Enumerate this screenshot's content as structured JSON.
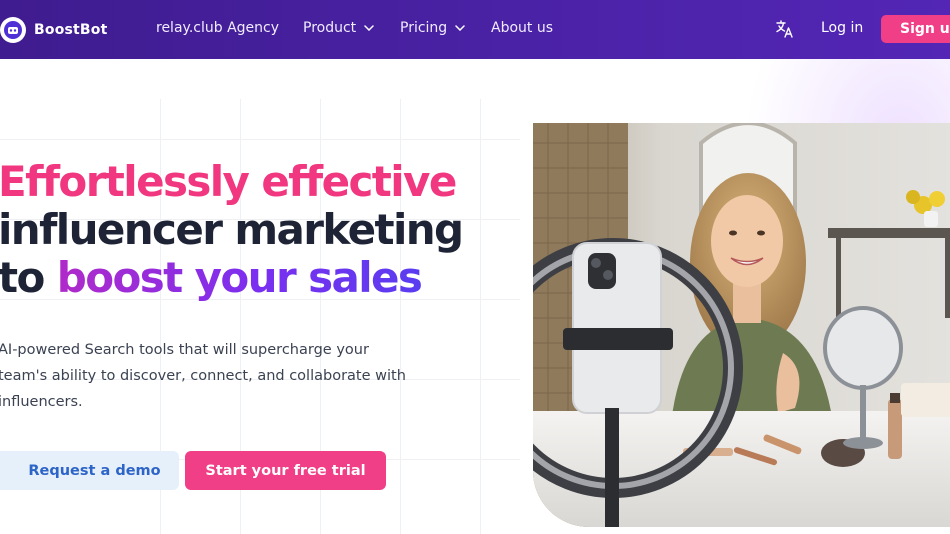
{
  "nav": {
    "brand": "BoostBot",
    "links": [
      {
        "label": "relay.club Agency",
        "has_dropdown": false
      },
      {
        "label": "Product",
        "has_dropdown": true
      },
      {
        "label": "Pricing",
        "has_dropdown": true
      },
      {
        "label": "About us",
        "has_dropdown": false
      }
    ],
    "language_icon": "translate-icon",
    "login_label": "Log in",
    "signup_label": "Sign up"
  },
  "hero": {
    "headline_line1": "Effortlessly effective",
    "headline_line2": "influencer marketing",
    "headline_line3_prefix": "to ",
    "headline_line3_highlight": "boost your sales",
    "subtitle": "AI-powered Search tools that will supercharge your team's ability to discover, connect, and collaborate with influencers.",
    "demo_button": "Request a demo",
    "trial_button": "Start your free trial"
  },
  "colors": {
    "nav_bg": "#4a22a6",
    "accent_pink": "#f03f86",
    "headline_dark": "#1e2436",
    "demo_bg": "#e6f0fb",
    "demo_text": "#2d64c8"
  }
}
